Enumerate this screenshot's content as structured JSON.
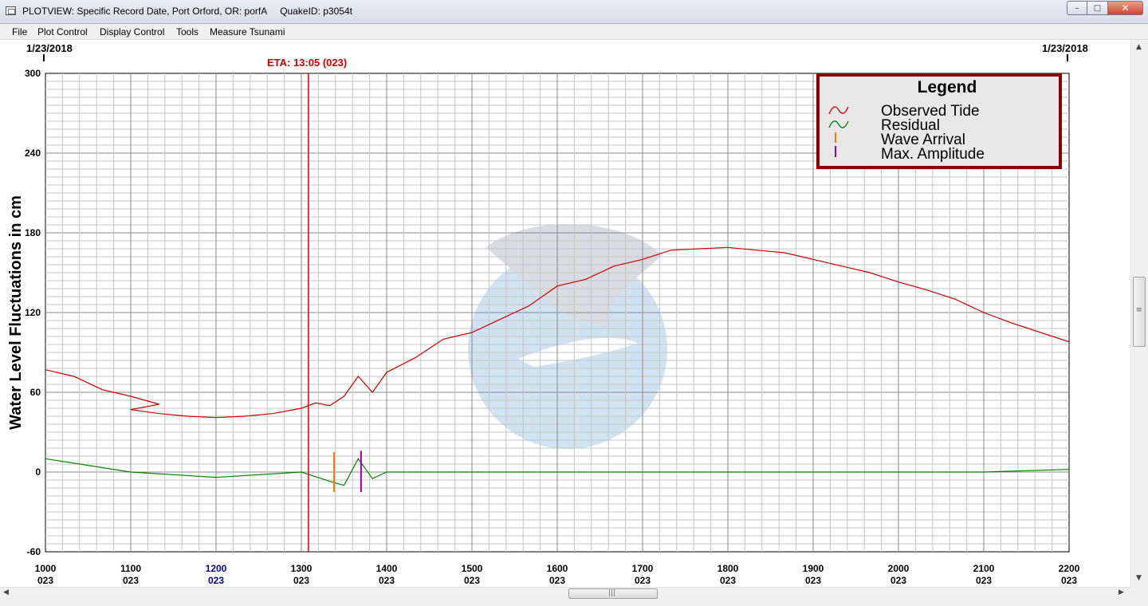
{
  "window": {
    "title": "PLOTVIEW: Specific Record Date, Port Orford, OR: porfA     QuakeID: p3054t",
    "controls": {
      "minimize": "–",
      "maximize": "□",
      "close": "✕"
    }
  },
  "menu": [
    "File",
    "Plot Control",
    "Display Control",
    "Tools",
    "Measure Tsunami"
  ],
  "chart_top": {
    "left_date": "1/23/2018",
    "right_date": "1/23/2018",
    "eta_label": "ETA: 13:05 (023)"
  },
  "colors": {
    "observed": "#cc0000",
    "residual": "#008000",
    "wave_arrival": "#e88000",
    "max_amplitude": "#9900aa",
    "eta_line": "#dd0000",
    "legend_border": "#8b0000",
    "highlight_tick": "#000099"
  },
  "scrollbar": {
    "h_grip": "|||",
    "v_grip": "≡"
  },
  "chart_data": {
    "type": "line",
    "ylabel": "Water Level Fluctuations in cm",
    "ylim": [
      -60,
      300
    ],
    "yticks": [
      -60,
      0,
      60,
      120,
      180,
      240,
      300
    ],
    "xlim": [
      1000,
      2200
    ],
    "xticks": [
      {
        "time": "1000",
        "day": "023"
      },
      {
        "time": "1100",
        "day": "023"
      },
      {
        "time": "1200",
        "day": "023",
        "highlight": true
      },
      {
        "time": "1300",
        "day": "023"
      },
      {
        "time": "1400",
        "day": "023"
      },
      {
        "time": "1500",
        "day": "023"
      },
      {
        "time": "1600",
        "day": "023"
      },
      {
        "time": "1700",
        "day": "023"
      },
      {
        "time": "1800",
        "day": "023"
      },
      {
        "time": "1900",
        "day": "023"
      },
      {
        "time": "2000",
        "day": "023"
      },
      {
        "time": "2100",
        "day": "023"
      },
      {
        "time": "2200",
        "day": "023"
      }
    ],
    "grid": true,
    "legend": {
      "title": "Legend",
      "position": "top-right",
      "entries": [
        "Observed Tide",
        "Residual",
        "Wave Arrival",
        "Max. Amplitude"
      ]
    },
    "eta_time": 1305,
    "wave_arrival_time": 1323,
    "max_amplitude_time": 1342,
    "series": [
      {
        "name": "Observed Tide",
        "x": [
          1000,
          1020,
          1040,
          1060,
          1080,
          1100,
          1120,
          1140,
          1200,
          1220,
          1240,
          1300,
          1310,
          1320,
          1330,
          1340,
          1350,
          1400,
          1420,
          1440,
          1500,
          1520,
          1540,
          1600,
          1620,
          1640,
          1700,
          1720,
          1740,
          1800,
          1820,
          1840,
          1900,
          1920,
          1940,
          2000,
          2020,
          2040,
          2100,
          2120,
          2140,
          2200
        ],
        "values": [
          77,
          72,
          62,
          57,
          51,
          47,
          44,
          42,
          41,
          42,
          44,
          48,
          52,
          50,
          57,
          72,
          60,
          75,
          86,
          100,
          105,
          115,
          125,
          140,
          145,
          155,
          160,
          167,
          168,
          169,
          167,
          165,
          160,
          155,
          150,
          143,
          137,
          130,
          120,
          112,
          105,
          98
        ]
      },
      {
        "name": "Residual",
        "x": [
          1000,
          1100,
          1200,
          1300,
          1320,
          1330,
          1340,
          1350,
          1400,
          1500,
          1600,
          1700,
          1800,
          1900,
          2000,
          2100,
          2200
        ],
        "values": [
          10,
          0,
          -4,
          0,
          -7,
          -10,
          10,
          -5,
          0,
          0,
          0,
          0,
          0,
          0,
          0,
          0,
          2
        ]
      }
    ]
  }
}
